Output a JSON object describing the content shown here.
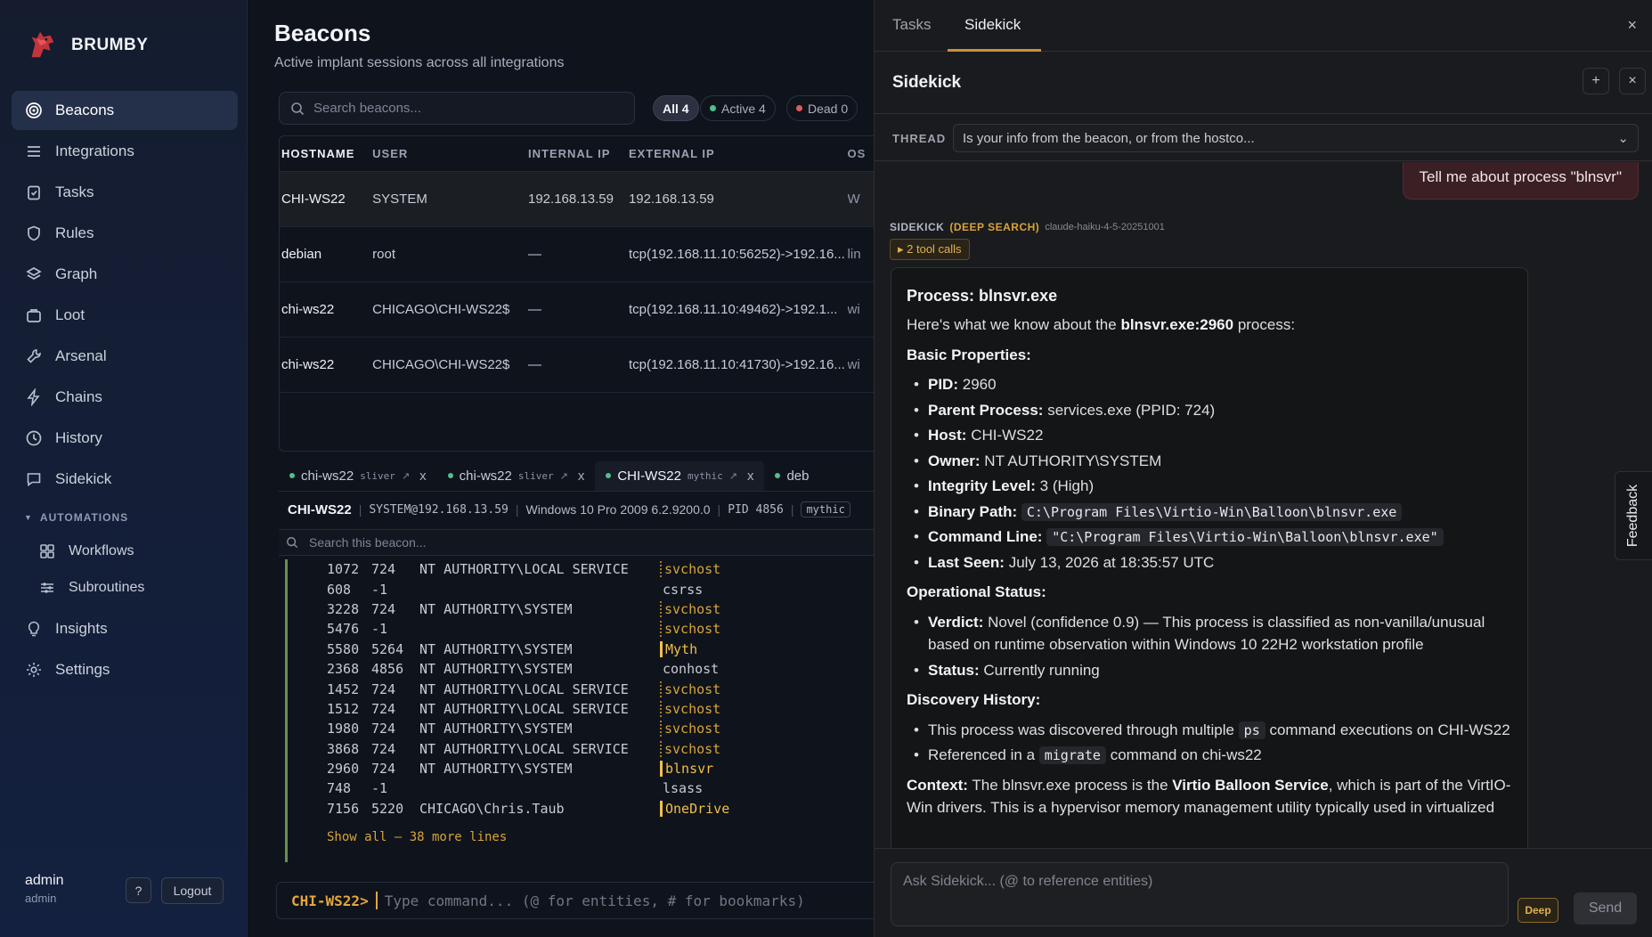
{
  "brand": {
    "name": "BRUMBY"
  },
  "nav": {
    "items": [
      {
        "label": "Beacons",
        "icon": "target-icon"
      },
      {
        "label": "Integrations",
        "icon": "list-icon"
      },
      {
        "label": "Tasks",
        "icon": "clipboard-icon"
      },
      {
        "label": "Rules",
        "icon": "shield-icon"
      },
      {
        "label": "Graph",
        "icon": "layers-icon"
      },
      {
        "label": "Loot",
        "icon": "briefcase-icon"
      },
      {
        "label": "Arsenal",
        "icon": "wrench-icon"
      },
      {
        "label": "Chains",
        "icon": "bolt-icon"
      },
      {
        "label": "History",
        "icon": "clock-icon"
      },
      {
        "label": "Sidekick",
        "icon": "chat-icon"
      }
    ],
    "section": "AUTOMATIONS",
    "sub_items": [
      {
        "label": "Workflows",
        "icon": "grid-icon"
      },
      {
        "label": "Subroutines",
        "icon": "sliders-icon"
      }
    ],
    "bottom_items": [
      {
        "label": "Insights",
        "icon": "bulb-icon"
      },
      {
        "label": "Settings",
        "icon": "gear-icon"
      }
    ]
  },
  "user": {
    "name": "admin",
    "role": "admin",
    "help": "?",
    "logout": "Logout"
  },
  "page": {
    "title": "Beacons",
    "subtitle": "Active implant sessions across all integrations",
    "search_placeholder": "Search beacons...",
    "filters": {
      "all": "All 4",
      "active": "Active 4",
      "dead": "Dead 0"
    }
  },
  "table": {
    "headers": [
      "HOSTNAME",
      "USER",
      "INTERNAL IP",
      "EXTERNAL IP",
      "OS"
    ],
    "rows": [
      {
        "host": "CHI-WS22",
        "user": "SYSTEM",
        "iip": "192.168.13.59",
        "eip": "192.168.13.59",
        "os": "W"
      },
      {
        "host": "debian",
        "user": "root",
        "iip": "—",
        "eip": "tcp(192.168.11.10:56252)->192.16...",
        "os": "lin"
      },
      {
        "host": "chi-ws22",
        "user": "CHICAGO\\CHI-WS22$",
        "iip": "—",
        "eip": "tcp(192.168.11.10:49462)->192.1...",
        "os": "wi"
      },
      {
        "host": "chi-ws22",
        "user": "CHICAGO\\CHI-WS22$",
        "iip": "—",
        "eip": "tcp(192.168.11.10:41730)->192.16...",
        "os": "wi"
      }
    ]
  },
  "beacon_tabs": [
    {
      "name": "chi-ws22",
      "tag": "sliver",
      "close": "x"
    },
    {
      "name": "chi-ws22",
      "tag": "sliver",
      "close": "x"
    },
    {
      "name": "CHI-WS22",
      "tag": "mythic",
      "close": "x"
    },
    {
      "name": "deb",
      "tag": "",
      "close": ""
    }
  ],
  "infobar": {
    "host": "CHI-WS22",
    "user": "SYSTEM@192.168.13.59",
    "os": "Windows 10 Pro 2009 6.2.9200.0",
    "pid": "PID 4856",
    "badge": "mythic"
  },
  "terminal": {
    "search_placeholder": "Search this beacon...",
    "lines": [
      {
        "pid": "1072",
        "ppid": "724",
        "owner": "NT AUTHORITY\\LOCAL SERVICE",
        "name": "svchost",
        "style": "warn"
      },
      {
        "pid": "608",
        "ppid": "-1",
        "owner": "",
        "name": "csrss",
        "style": ""
      },
      {
        "pid": "3228",
        "ppid": "724",
        "owner": "NT AUTHORITY\\SYSTEM",
        "name": "svchost",
        "style": "warn"
      },
      {
        "pid": "5476",
        "ppid": "-1",
        "owner": "",
        "name": "svchost",
        "style": "warn"
      },
      {
        "pid": "5580",
        "ppid": "5264",
        "owner": "NT AUTHORITY\\SYSTEM",
        "name": "Myth",
        "style": "hl"
      },
      {
        "pid": "2368",
        "ppid": "4856",
        "owner": "NT AUTHORITY\\SYSTEM",
        "name": "conhost",
        "style": ""
      },
      {
        "pid": "1452",
        "ppid": "724",
        "owner": "NT AUTHORITY\\LOCAL SERVICE",
        "name": "svchost",
        "style": "warn"
      },
      {
        "pid": "1512",
        "ppid": "724",
        "owner": "NT AUTHORITY\\LOCAL SERVICE",
        "name": "svchost",
        "style": "warn"
      },
      {
        "pid": "1980",
        "ppid": "724",
        "owner": "NT AUTHORITY\\SYSTEM",
        "name": "svchost",
        "style": "warn"
      },
      {
        "pid": "3868",
        "ppid": "724",
        "owner": "NT AUTHORITY\\LOCAL SERVICE",
        "name": "svchost",
        "style": "warn"
      },
      {
        "pid": "2960",
        "ppid": "724",
        "owner": "NT AUTHORITY\\SYSTEM",
        "name": "blnsvr",
        "style": "hl"
      },
      {
        "pid": "748",
        "ppid": "-1",
        "owner": "",
        "name": "lsass",
        "style": ""
      },
      {
        "pid": "7156",
        "ppid": "5220",
        "owner": "CHICAGO\\Chris.Taub",
        "name": "OneDrive",
        "style": "hl"
      }
    ],
    "show_more": "Show all — 38 more lines"
  },
  "command": {
    "prompt": "CHI-WS22>",
    "placeholder": "Type command... (@ for entities, # for bookmarks)"
  },
  "panel": {
    "tabs": [
      "Tasks",
      "Sidekick"
    ],
    "title": "Sidekick",
    "thread_label": "THREAD",
    "thread_value": "Is your info from the beacon, or from the hostco...",
    "user_message": "Tell me about process \"blnsvr\"",
    "meta_who": "SIDEKICK",
    "meta_mode": "(DEEP SEARCH)",
    "meta_model": "claude-haiku-4-5-20251001",
    "tool_calls": "▸ 2 tool calls",
    "answer": {
      "heading": "Process: blnsvr.exe",
      "intro_pre": "Here's what we know about the ",
      "intro_bold": "blnsvr.exe:2960",
      "intro_post": " process:",
      "basic_title": "Basic Properties:",
      "basic": [
        {
          "k": "PID:",
          "v": "2960"
        },
        {
          "k": "Parent Process:",
          "v": "services.exe (PPID: 724)"
        },
        {
          "k": "Host:",
          "v": "CHI-WS22"
        },
        {
          "k": "Owner:",
          "v": "NT AUTHORITY\\SYSTEM"
        },
        {
          "k": "Integrity Level:",
          "v": "3 (High)"
        }
      ],
      "binary_k": "Binary Path:",
      "binary_v": "C:\\Program Files\\Virtio-Win\\Balloon\\blnsvr.exe",
      "cmd_k": "Command Line:",
      "cmd_v": "\"C:\\Program Files\\Virtio-Win\\Balloon\\blnsvr.exe\"",
      "seen_k": "Last Seen:",
      "seen_v": "July 13, 2026 at 18:35:57 UTC",
      "ops_title": "Operational Status:",
      "verdict_k": "Verdict:",
      "verdict_v": "Novel (confidence 0.9) — This process is classified as non-vanilla/unusual based on runtime observation within Windows 10 22H2 workstation profile",
      "status_k": "Status:",
      "status_v": "Currently running",
      "disc_title": "Discovery History:",
      "disc1_pre": "This process was discovered through multiple ",
      "disc1_code": "ps",
      "disc1_post": " command executions on CHI-WS22",
      "disc2_pre": "Referenced in a ",
      "disc2_code": "migrate",
      "disc2_post": " command on chi-ws22",
      "ctx_k": "Context:",
      "ctx_pre": " The blnsvr.exe process is the ",
      "ctx_bold": "Virtio Balloon Service",
      "ctx_post": ", which is part of the VirtIO-Win drivers. This is a hypervisor memory management utility typically used in virtualized"
    },
    "ask_placeholder": "Ask Sidekick... (@ to reference entities)",
    "deep_label": "Deep",
    "send_label": "Send",
    "add_label": "+",
    "close_label": "×"
  },
  "feedback": "Feedback",
  "colors": {
    "accent": "#c8913a",
    "active_dot": "#4fc08d",
    "dead_dot": "#e05a5a",
    "highlight": "#f0bf4c"
  }
}
